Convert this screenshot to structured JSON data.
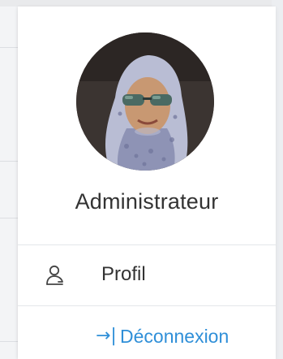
{
  "user": {
    "name": "Administrateur",
    "avatar_icon": "user-avatar-photo"
  },
  "menu": {
    "profil": {
      "label": "Profil",
      "icon": "user-outline-icon"
    },
    "logout": {
      "label": "Déconnexion",
      "icon": "logout-arrow-icon",
      "icon_glyph": "→|"
    }
  },
  "colors": {
    "link": "#2f8fd8",
    "text": "#333333",
    "divider": "#e4e6ea"
  }
}
